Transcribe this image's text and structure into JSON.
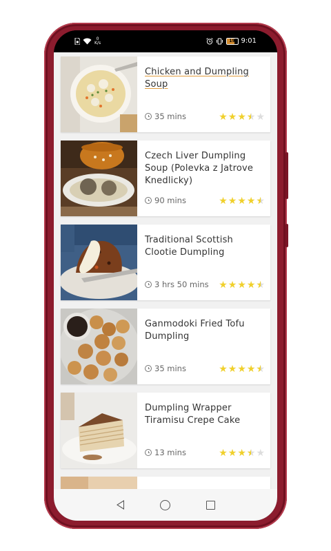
{
  "status_bar": {
    "network_speed_value": "0",
    "network_speed_unit": "K/s",
    "battery_level": "19",
    "time": "9:01"
  },
  "recipes": [
    {
      "title": "Chicken and Dumpling Soup",
      "time": "35 mins",
      "rating": 3.5,
      "image": "chicken-dumpling-soup-photo",
      "linked": true
    },
    {
      "title": "Czech Liver Dumpling Soup (Polevka z Jatrove Knedlicky)",
      "time": "90 mins",
      "rating": 4.5,
      "image": "czech-liver-dumpling-soup-photo",
      "linked": false
    },
    {
      "title": "Traditional Scottish Clootie Dumpling",
      "time": "3 hrs 50 mins",
      "rating": 4.5,
      "image": "clootie-dumpling-photo",
      "linked": false
    },
    {
      "title": "Ganmodoki Fried Tofu Dumpling",
      "time": "35 mins",
      "rating": 4.5,
      "image": "fried-tofu-dumpling-photo",
      "linked": false
    },
    {
      "title": "Dumpling Wrapper Tiramisu Crepe Cake",
      "time": "13 mins",
      "rating": 3.5,
      "image": "tiramisu-crepe-cake-photo",
      "linked": false
    }
  ],
  "navigation": {
    "back_icon": "back-triangle-icon",
    "home_icon": "home-circle-icon",
    "recent_icon": "recent-apps-square-icon"
  },
  "colors": {
    "phone_frame": "#8c1c2e",
    "star_filled": "#f0d02c",
    "star_empty": "#dddddd",
    "title_underline": "#e09a3a"
  }
}
